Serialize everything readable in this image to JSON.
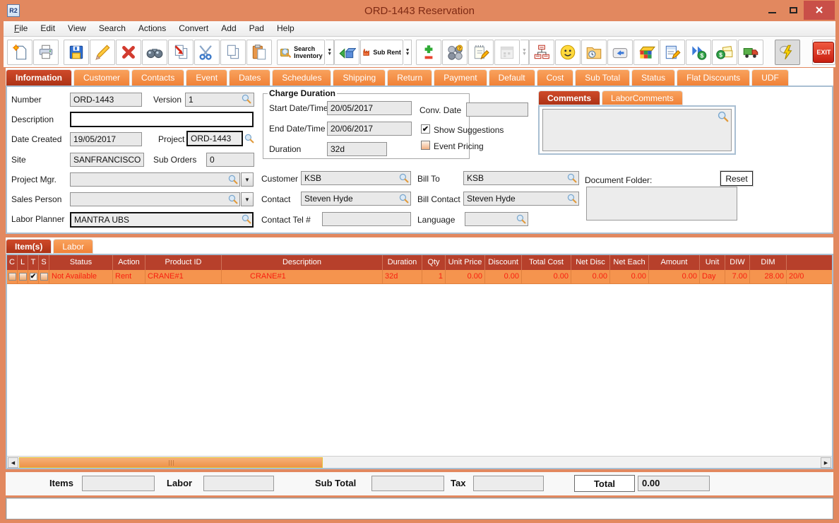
{
  "window": {
    "title": "ORD-1443 Reservation",
    "app_icon_text": "R2"
  },
  "menu": {
    "items": [
      "File",
      "Edit",
      "View",
      "Search",
      "Actions",
      "Convert",
      "Add",
      "Pad",
      "Help"
    ]
  },
  "toolbar": {
    "search_inventory_label": "Search Inventory",
    "sub_rent_label": "Sub Rent",
    "exit_label": "EXIT"
  },
  "tabs": {
    "active": "Information",
    "items": [
      "Information",
      "Customer",
      "Contacts",
      "Event",
      "Dates",
      "Schedules",
      "Shipping",
      "Return",
      "Payment",
      "Default",
      "Cost",
      "Sub Total",
      "Status",
      "Flat Discounts",
      "UDF"
    ]
  },
  "form": {
    "number": {
      "label": "Number",
      "value": "ORD-1443"
    },
    "version": {
      "label": "Version",
      "value": "1"
    },
    "description": {
      "label": "Description",
      "value": ""
    },
    "date_created": {
      "label": "Date Created",
      "value": "19/05/2017"
    },
    "project": {
      "label": "Project",
      "value": "ORD-1443"
    },
    "site": {
      "label": "Site",
      "value": "SANFRANCISCO"
    },
    "sub_orders": {
      "label": "Sub Orders",
      "value": "0"
    },
    "project_mgr": {
      "label": "Project Mgr.",
      "value": ""
    },
    "sales_person": {
      "label": "Sales Person",
      "value": ""
    },
    "labor_planner": {
      "label": "Labor Planner",
      "value": "MANTRA UBS"
    },
    "charge_duration": {
      "title": "Charge Duration",
      "start": {
        "label": "Start Date/Time",
        "value": "20/05/2017"
      },
      "end": {
        "label": "End Date/Time",
        "value": "20/06/2017"
      },
      "duration": {
        "label": "Duration",
        "value": "32d"
      }
    },
    "conv_date": {
      "label": "Conv. Date",
      "value": ""
    },
    "show_suggestions": {
      "label": "Show Suggestions",
      "checked": true,
      "mark": "✔"
    },
    "event_pricing": {
      "label": "Event Pricing",
      "checked": false,
      "mark": ""
    },
    "customer": {
      "label": "Customer",
      "value": "KSB"
    },
    "bill_to": {
      "label": "Bill To",
      "value": "KSB"
    },
    "contact": {
      "label": "Contact",
      "value": "Steven Hyde"
    },
    "bill_contact": {
      "label": "Bill Contact",
      "value": "Steven Hyde"
    },
    "contact_tel": {
      "label": "Contact Tel #",
      "value": ""
    },
    "language": {
      "label": "Language",
      "value": ""
    }
  },
  "comments_panel": {
    "active": "Comments",
    "tabs": [
      "Comments",
      "LaborComments"
    ],
    "comment_text": "",
    "document_folder_label": "Document Folder:",
    "document_folder_value": "",
    "reset_label": "Reset"
  },
  "items_panel": {
    "active": "Item(s)",
    "tabs": [
      "Item(s)",
      "Labor"
    ]
  },
  "items_table": {
    "columns": [
      "C",
      "L",
      "T",
      "S",
      "Status",
      "Action",
      "Product ID",
      "Description",
      "Duration",
      "Qty",
      "Unit Price",
      "Discount",
      "Total Cost",
      "Net Disc",
      "Net Each",
      "Amount",
      "Unit",
      "DIW",
      "DIM",
      ""
    ],
    "rows": [
      {
        "checks": [
          "",
          "",
          "✔",
          ""
        ],
        "status": "Not Available",
        "action": "Rent",
        "product_id": "CRANE#1",
        "description": "CRANE#1",
        "duration": "32d",
        "qty": "1",
        "unit_price": "0.00",
        "discount": "0.00",
        "total_cost": "0.00",
        "net_disc": "0.00",
        "net_each": "0.00",
        "amount": "0.00",
        "unit": "Day",
        "diw": "7.00",
        "dim": "28.00",
        "extra": "20/0"
      }
    ]
  },
  "totals": {
    "items_label": "Items",
    "items_value": "",
    "labor_label": "Labor",
    "labor_value": "",
    "sub_total_label": "Sub Total",
    "sub_total_value": "",
    "tax_label": "Tax",
    "tax_value": "",
    "total_label": "Total",
    "total_value": "0.00"
  },
  "status_bar": {
    "text": ""
  },
  "colors": {
    "window_frame": "#e2885f",
    "active_tab": "#b7402b",
    "inactive_tab": "#f5944e",
    "table_header": "#b7402b",
    "row_text": "#f71f10",
    "close_button": "#c94f48"
  }
}
